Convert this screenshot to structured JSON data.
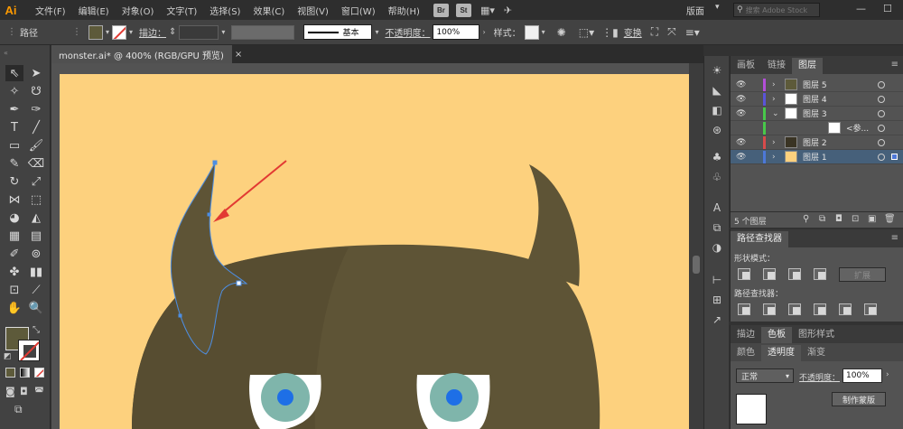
{
  "menubar": {
    "app_logo": "Ai",
    "items": [
      "文件(F)",
      "编辑(E)",
      "对象(O)",
      "文字(T)",
      "选择(S)",
      "效果(C)",
      "视图(V)",
      "窗口(W)",
      "帮助(H)"
    ],
    "bridge_badge": "Br",
    "stock_badge": "St",
    "workspace": "版面",
    "search_placeholder": "搜索 Adobe Stock"
  },
  "controlbar": {
    "selection_label": "路径",
    "stroke_label": "描边：",
    "brush_label": "基本",
    "opacity_label": "不透明度：",
    "opacity_value": "100%",
    "style_label": "样式：",
    "transform_label": "变换"
  },
  "document": {
    "tab_title": "monster.ai* @ 400% (RGB/GPU 预览)",
    "close_glyph": "×"
  },
  "colors": {
    "artboard_bg": "#fdd17e",
    "monster_body": "#5e5436",
    "monster_shadow": "#574d31",
    "eye_iris": "#7fb5ab",
    "eye_pupil": "#1e6fe6",
    "annotation_arrow": "#e23a33",
    "path_selection": "#4d8ee3",
    "fill_swatch": "#5d5a3a"
  },
  "layers_panel": {
    "tabs": [
      "画板",
      "链接",
      "图层"
    ],
    "active_tab": "图层",
    "rows": [
      {
        "name": "图层 5",
        "color": "#b34fd8"
      },
      {
        "name": "图层 4",
        "color": "#5a54d8"
      },
      {
        "name": "图层 3",
        "color": "#48c84a"
      },
      {
        "name": "<参...",
        "color": "#48c84a"
      },
      {
        "name": "图层 2",
        "color": "#d84b4b"
      },
      {
        "name": "图层 1",
        "color": "#4d78d8"
      }
    ],
    "count_label": "5 个图层"
  },
  "pathfinder_panel": {
    "title": "路径查找器",
    "shape_modes_label": "形状模式：",
    "expand_label": "扩展",
    "pathfinders_label": "路径查找器："
  },
  "transparency_panel": {
    "tabs": [
      "描边",
      "色板",
      "图形样式"
    ],
    "active_tab": "色板",
    "subtabs": [
      "颜色",
      "透明度",
      "渐变"
    ],
    "active_subtab": "透明度",
    "blend_mode": "正常",
    "opacity_label": "不透明度：",
    "opacity_value": "100%",
    "make_mask_label": "制作蒙版"
  }
}
